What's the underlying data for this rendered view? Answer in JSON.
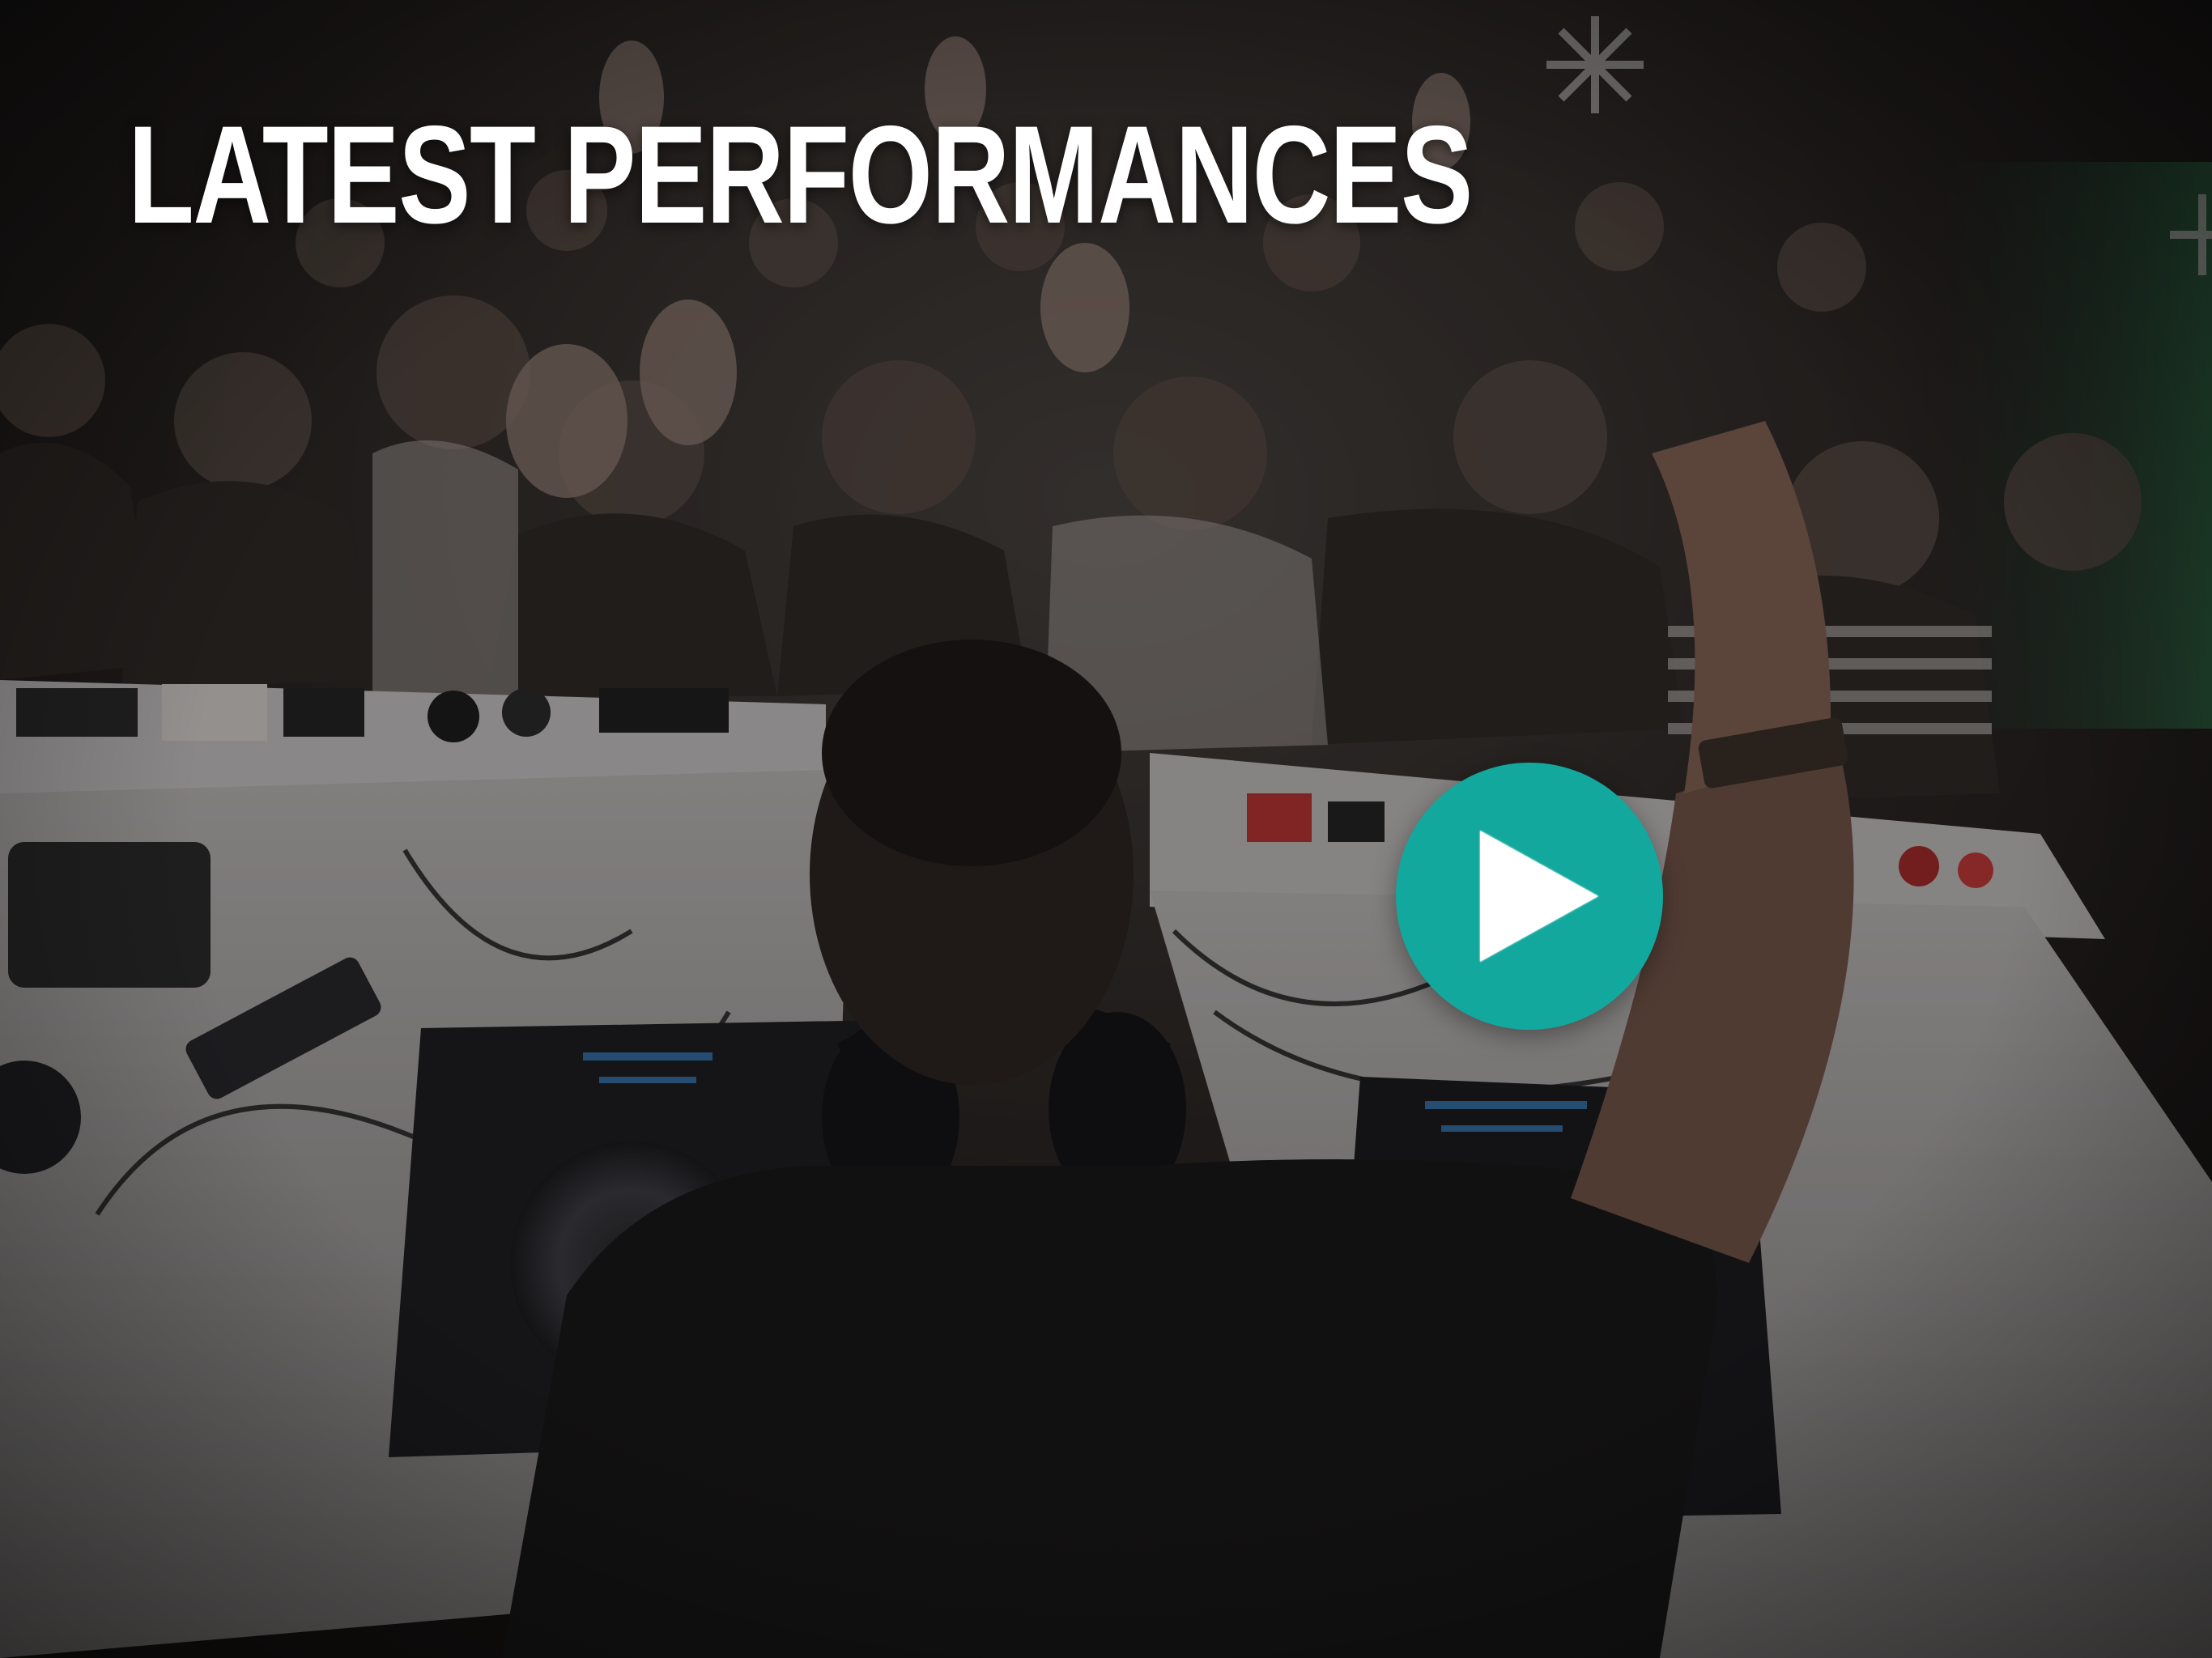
{
  "hero": {
    "title": "LATEST PERFORMANCES",
    "background_image": "dj-performing-to-crowd-photo",
    "play_button": {
      "icon": "play-icon",
      "color": "#13a89e",
      "icon_color": "#ffffff"
    }
  }
}
